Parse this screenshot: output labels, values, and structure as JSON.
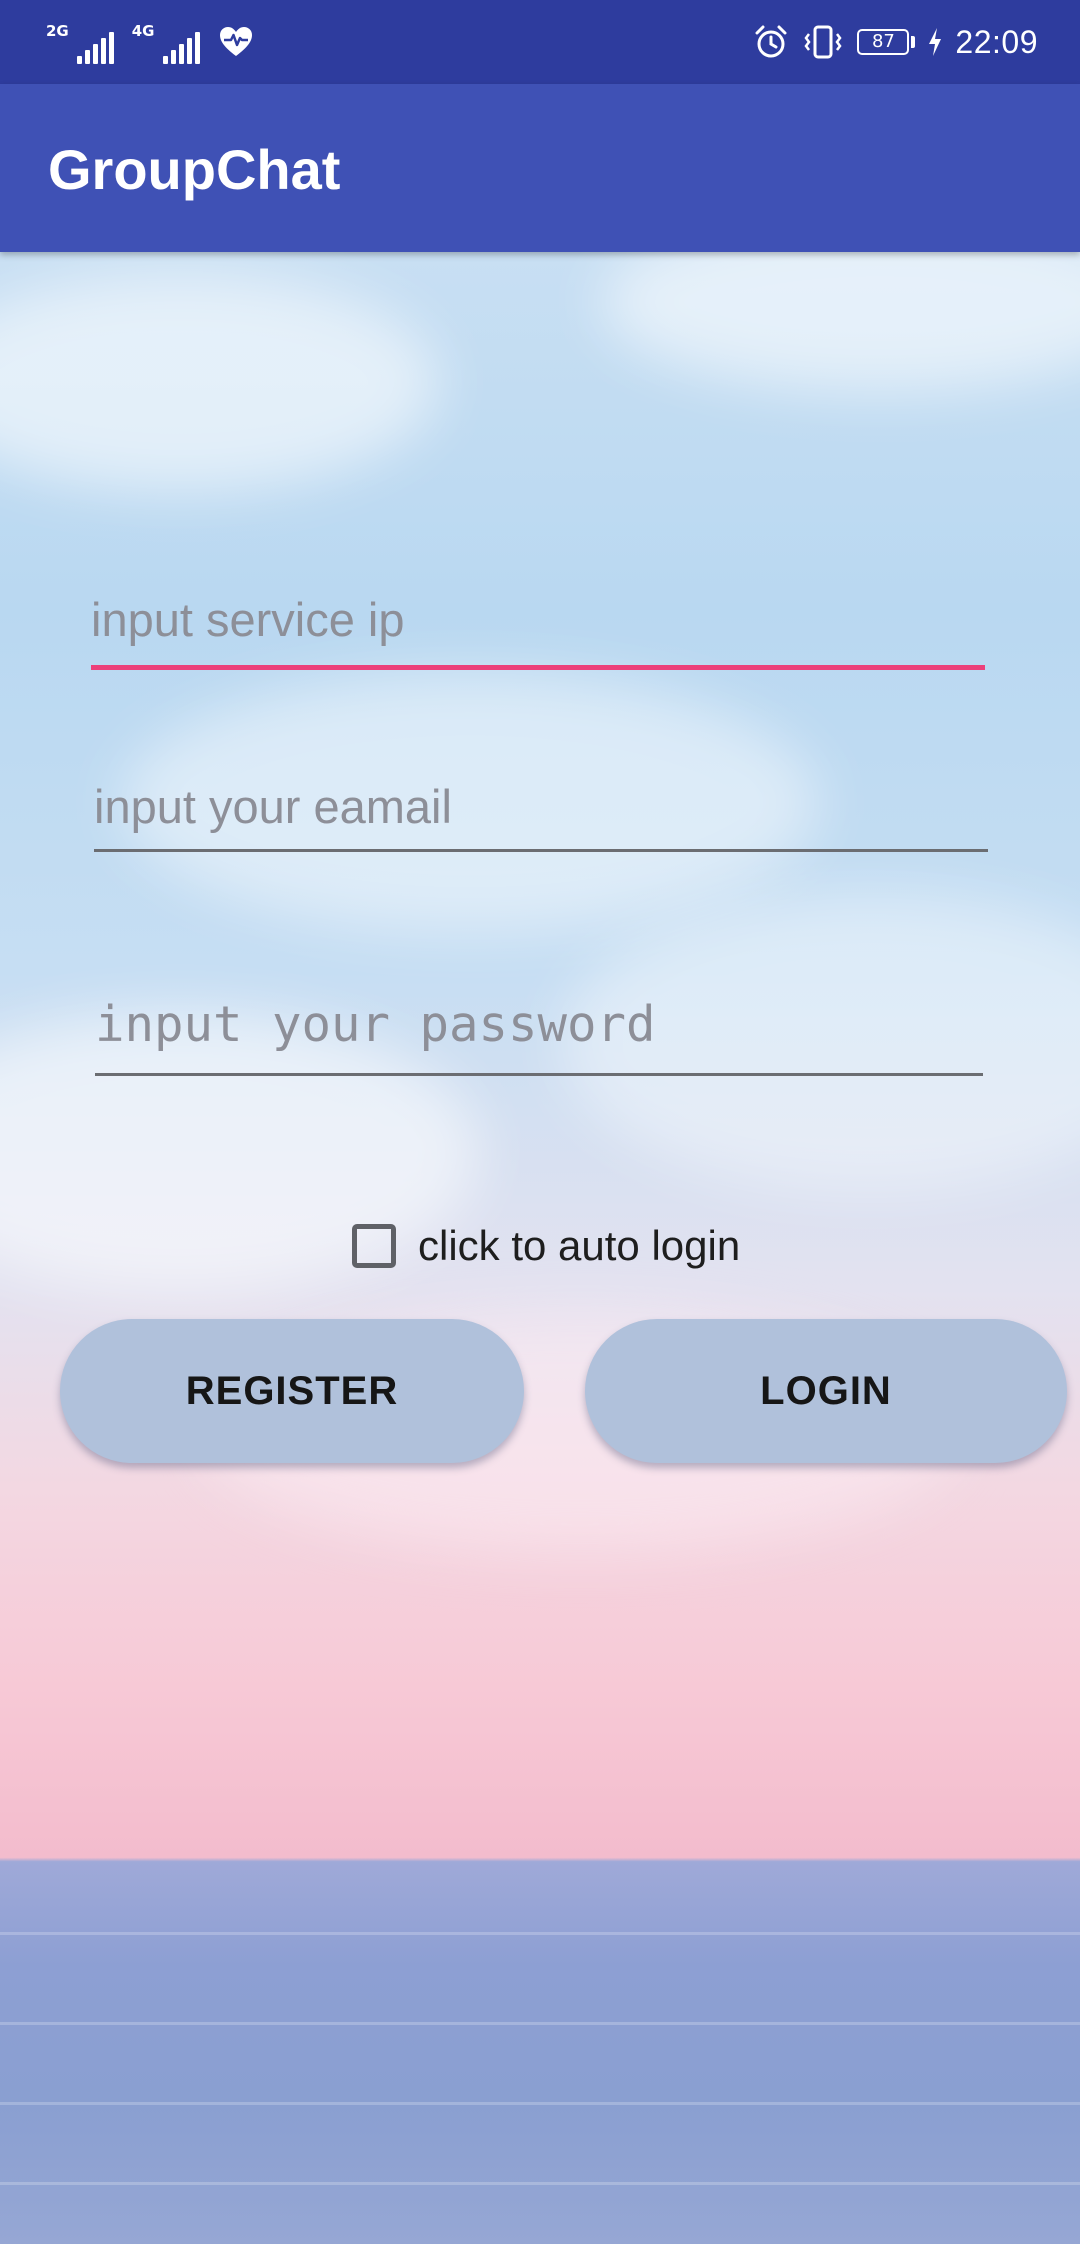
{
  "status_bar": {
    "network_1": "2G",
    "network_2": "4G",
    "battery_level": "87",
    "time": "22:09",
    "icons": [
      "signal-icon",
      "signal-icon",
      "health-heart-icon",
      "alarm-icon",
      "vibrate-icon",
      "battery-icon",
      "charging-bolt-icon"
    ]
  },
  "app_bar": {
    "title": "GroupChat"
  },
  "login_form": {
    "service_ip": {
      "value": "",
      "placeholder": "input service ip"
    },
    "email": {
      "value": "",
      "placeholder": "input your eamail"
    },
    "password": {
      "value": "",
      "placeholder": "input your password"
    },
    "auto_login": {
      "label": "click to auto login",
      "checked": false
    },
    "register_label": "REGISTER",
    "login_label": "LOGIN"
  },
  "colors": {
    "status_bar": "#2e3c9e",
    "app_bar": "#3f51b5",
    "focus_underline": "#ec407a",
    "button": "#b0c1db"
  }
}
